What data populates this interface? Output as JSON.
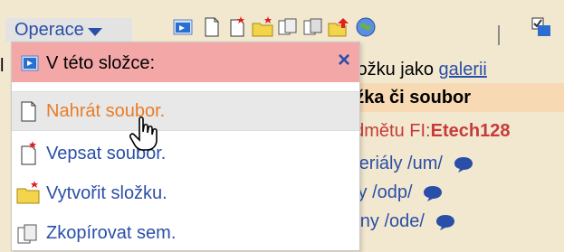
{
  "toolbar": {
    "operations_label": "Operace"
  },
  "listing": {
    "first_line_prefix": "složku jako ",
    "first_line_link": "galerii",
    "header_text": "ožka či soubor",
    "subject_prefix": "edmětu FI:",
    "subject_code": "Etech128",
    "rows": [
      {
        "label": "ateriály /um/"
      },
      {
        "label": "íky /odp/"
      },
      {
        "label": "árny /ode/"
      }
    ]
  },
  "dropdown": {
    "header_label": "V této složce:",
    "close_symbol": "×",
    "items": [
      {
        "label": "Nahrát soubor."
      },
      {
        "label": "Vepsat soubor."
      },
      {
        "label": "Vytvořit složku."
      },
      {
        "label": "Zkopírovat sem."
      }
    ]
  },
  "colors": {
    "background": "#f2e8cf",
    "link_blue": "#2a4fa8",
    "menu_header_pink": "#f4a7a7",
    "hover_orange": "#e87d2a",
    "subject_red": "#c83a3a"
  }
}
